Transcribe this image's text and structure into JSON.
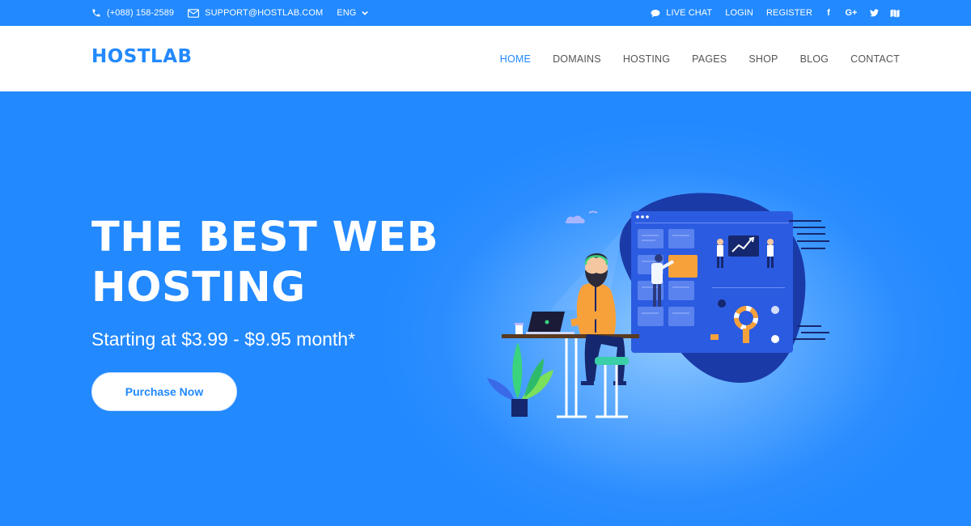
{
  "topbar": {
    "phone": "(+088) 158-2589",
    "email": "SUPPORT@HOSTLAB.COM",
    "language": "ENG",
    "live_chat": "LIVE CHAT",
    "login": "LOGIN",
    "register": "REGISTER",
    "social": [
      "facebook-icon",
      "google-plus-icon",
      "twitter-icon",
      "map-icon"
    ]
  },
  "header": {
    "logo": "HOSTLAB",
    "nav": [
      "HOME",
      "DOMAINS",
      "HOSTING",
      "PAGES",
      "SHOP",
      "BLOG",
      "CONTACT"
    ],
    "active": "HOME"
  },
  "hero": {
    "title_line1": "THE BEST WEB",
    "title_line2": "HOSTING",
    "subtitle": "Starting at $3.99 - $9.95 month*",
    "button": "Purchase Now"
  },
  "colors": {
    "brand": "#2289ff",
    "accent_orange": "#f7a13b",
    "dark_blue": "#1a3aa8"
  }
}
